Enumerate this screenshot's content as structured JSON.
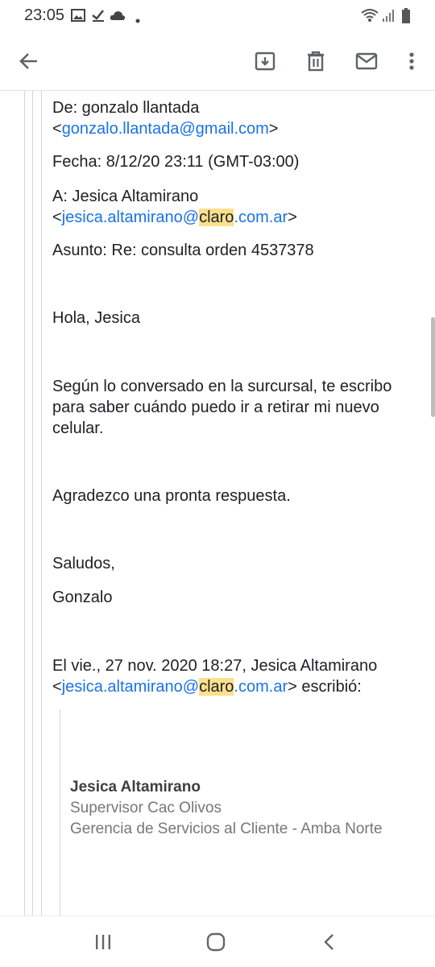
{
  "status_bar": {
    "time": "23:05",
    "left_icons": [
      "image-icon",
      "check-icon",
      "cloud-icon",
      "dot-icon"
    ],
    "right_icons": [
      "wifi-icon",
      "signal-icon",
      "battery-icon"
    ]
  },
  "toolbar": {
    "actions": [
      "back-arrow-icon",
      "archive-icon",
      "delete-icon",
      "mark-unread-icon",
      "more-options-icon"
    ]
  },
  "email": {
    "from_label": "De: gonzalo llantada",
    "from_email": "gonzalo.llantada@gmail.com",
    "date_line": "Fecha: 8/12/20 23:11 (GMT-03:00)",
    "to_label": "A: Jesica Altamirano",
    "to_email_user": "jesica.altamirano@",
    "to_email_highlight": "claro",
    "to_email_domain": ".com.ar",
    "subject_line": "Asunto: Re: consulta orden 4537378",
    "greeting": "Hola, Jesica",
    "body_line_1": "Según lo conversado en la surcursal, te escribo",
    "body_line_2": "para saber cuándo puedo ir a retirar mi nuevo",
    "body_line_3": "celular.",
    "thanks": "Agradezco una pronta respuesta.",
    "closing": "Saludos,",
    "sender_name": "Gonzalo",
    "quote_intro": "El vie., 27 nov. 2020 18:27, Jesica Altamirano",
    "quote_email_user": "jesica.altamirano@",
    "quote_email_highlight": "claro",
    "quote_email_domain": ".com.ar",
    "quote_suffix": " escribió:"
  },
  "signature": {
    "name": "Jesica Altamirano",
    "title": "Supervisor Cac Olivos",
    "department": "Gerencia de Servicios al Cliente - Amba Norte"
  },
  "nav_bar": {
    "buttons": [
      "recents-icon",
      "home-icon",
      "back-icon"
    ]
  },
  "colors": {
    "link": "#1a73e8",
    "highlight": "#fbe08e",
    "quote_line": "#d6d6d6"
  }
}
